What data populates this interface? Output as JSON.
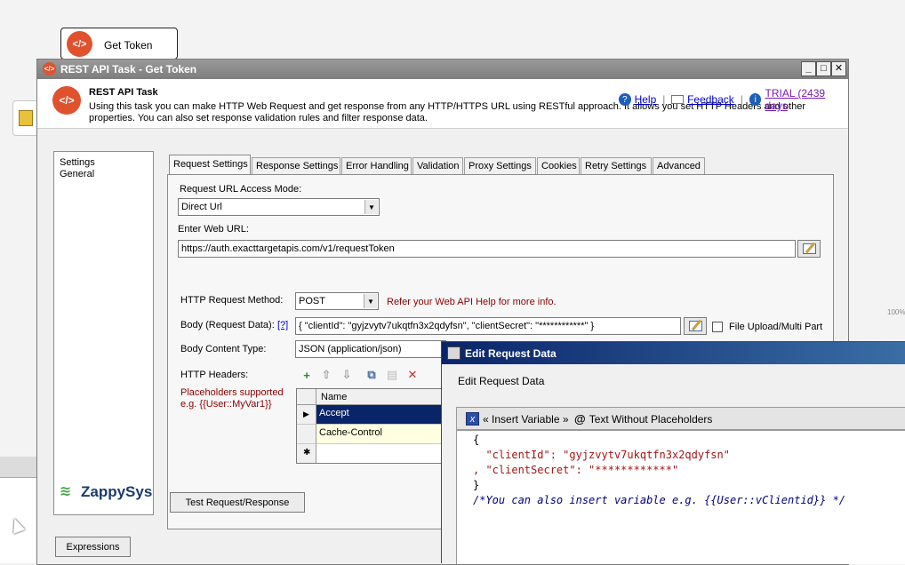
{
  "designer": {
    "task_box_label": "Get Token",
    "zoom_fragment": "100%"
  },
  "dialog": {
    "title": "REST API Task - Get Token",
    "header_title": "REST API Task",
    "header_desc": "Using this task you can make HTTP Web Request and get response from any HTTP/HTTPS URL using RESTful approach. It allows you set HTTP Headers and other properties. You can also set response validation rules and filter response data.",
    "help_label": "Help",
    "feedback_label": "Feedback",
    "trial_label": "TRIAL (2439 days"
  },
  "nav": {
    "items": [
      "Settings",
      "General"
    ],
    "logo_text": "ZappySys"
  },
  "tabs": [
    {
      "label": "Request Settings"
    },
    {
      "label": "Response Settings"
    },
    {
      "label": "Error Handling"
    },
    {
      "label": "Validation"
    },
    {
      "label": "Proxy Settings"
    },
    {
      "label": "Cookies"
    },
    {
      "label": "Retry Settings"
    },
    {
      "label": "Advanced"
    }
  ],
  "request": {
    "access_mode_label": "Request URL Access Mode:",
    "access_mode_value": "Direct Url",
    "url_label": "Enter Web URL:",
    "url_value": "https://auth.exacttargetapis.com/v1/requestToken",
    "method_label": "HTTP Request Method:",
    "method_value": "POST",
    "method_hint": "Refer your Web API Help for more info.",
    "body_label": "Body (Request Data):",
    "body_help": "[?]",
    "body_value": "{ \"clientId\": \"gyjzvytv7ukqtfn3x2qdyfsn\", \"clientSecret\": \"************\" }",
    "file_upload_label": "File Upload/Multi Part",
    "content_type_label": "Body Content Type:",
    "content_type_value": "JSON (application/json)",
    "headers_label": "HTTP Headers:",
    "placeholders_hint": "Placeholders supported e.g. {{User::MyVar1}}",
    "headers_grid": {
      "column": "Name",
      "rows": [
        "Accept",
        "Cache-Control",
        ""
      ]
    },
    "test_button": "Test Request/Response",
    "expressions_button": "Expressions"
  },
  "edit_dialog": {
    "title": "Edit Request Data",
    "subtitle": "Edit Request Data",
    "insert_variable": "« Insert Variable »",
    "text_without_placeholders": "Text Without Placeholders",
    "code_lines": [
      "{",
      "  \"clientId\": \"gyjzvytv7ukqtfn3x2qdyfsn\"",
      ", \"clientSecret\": \"************\"",
      "}",
      "/*You can also insert variable e.g. {{User::vClientid}} */"
    ]
  }
}
